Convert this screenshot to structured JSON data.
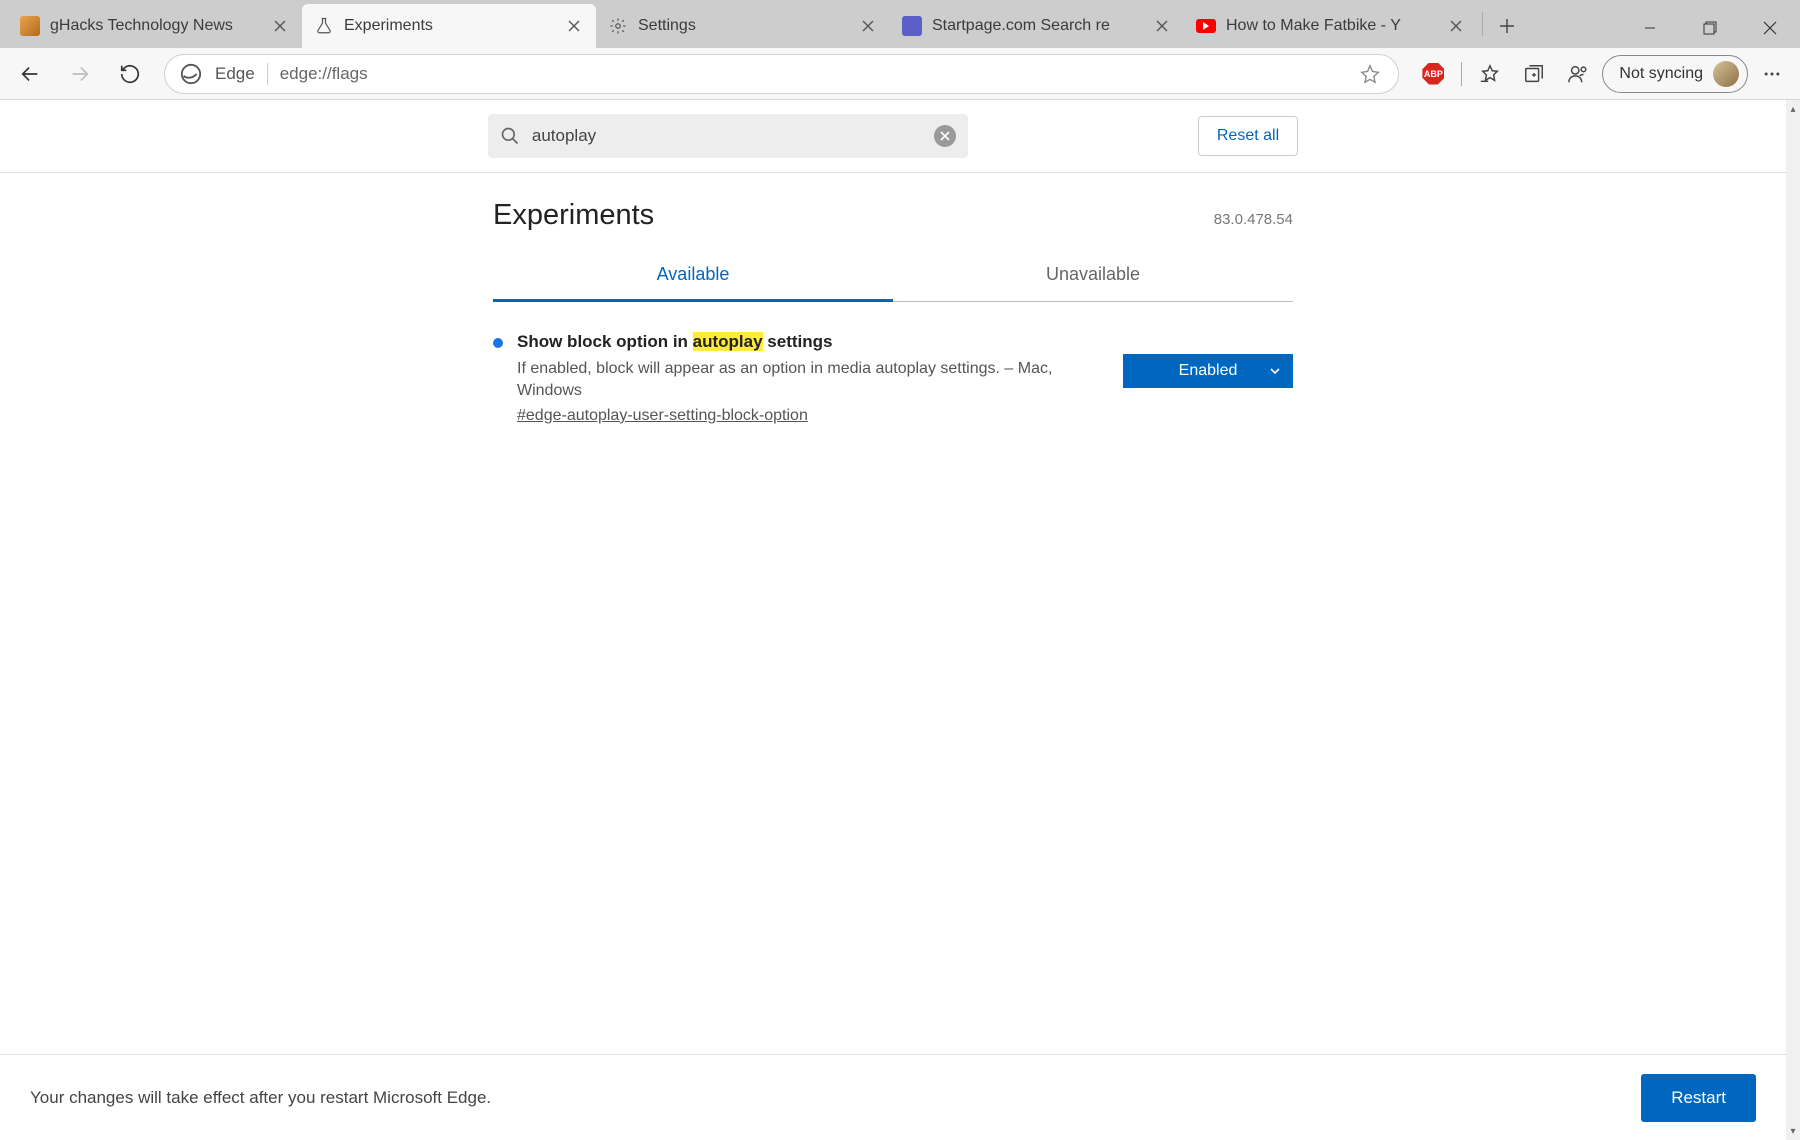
{
  "tabs": [
    {
      "title": "gHacks Technology News"
    },
    {
      "title": "Experiments"
    },
    {
      "title": "Settings"
    },
    {
      "title": "Startpage.com Search re"
    },
    {
      "title": "How to Make Fatbike - Y"
    }
  ],
  "omnibox": {
    "label": "Edge",
    "url": "edge://flags"
  },
  "sync_label": "Not syncing",
  "search": {
    "value": "autoplay"
  },
  "reset_label": "Reset all",
  "page_title": "Experiments",
  "version": "83.0.478.54",
  "content_tabs": {
    "available": "Available",
    "unavailable": "Unavailable"
  },
  "flag": {
    "title_pre": "Show block option in ",
    "title_hl": "autoplay",
    "title_post": " settings",
    "desc": "If enabled, block will appear as an option in media autoplay settings. – Mac, Windows",
    "hash": "#edge-autoplay-user-setting-block-option",
    "select_value": "Enabled"
  },
  "footer_msg": "Your changes will take effect after you restart Microsoft Edge.",
  "restart_label": "Restart"
}
